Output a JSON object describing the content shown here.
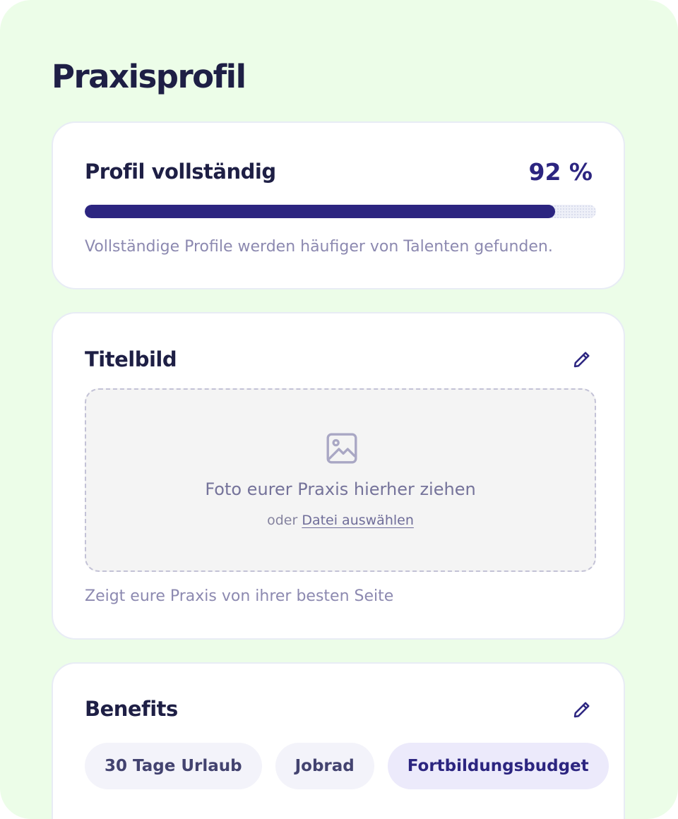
{
  "page": {
    "title": "Praxisprofil"
  },
  "profile_completion": {
    "heading": "Profil vollständig",
    "percent_label": "92 %",
    "progress_fraction": 0.92,
    "hint": "Vollständige Profile werden häufiger von Talenten gefunden."
  },
  "cover_image": {
    "heading": "Titelbild",
    "edit_icon": "pencil-icon",
    "dropzone": {
      "icon": "image-icon",
      "title": "Foto eurer Praxis hierher ziehen",
      "or_text": "oder",
      "link_text": "Datei auswählen"
    },
    "hint": "Zeigt eure Praxis von ihrer besten Seite"
  },
  "benefits": {
    "heading": "Benefits",
    "edit_icon": "pencil-icon",
    "chips": [
      {
        "label": "30 Tage Urlaub",
        "selected": false
      },
      {
        "label": "Jobrad",
        "selected": false
      },
      {
        "label": "Fortbildungsbudget",
        "selected": true
      }
    ]
  },
  "colors": {
    "background": "#ecfde8",
    "accent": "#2c2580",
    "text_dark": "#1e1f45",
    "text_muted": "#8c89b0"
  }
}
